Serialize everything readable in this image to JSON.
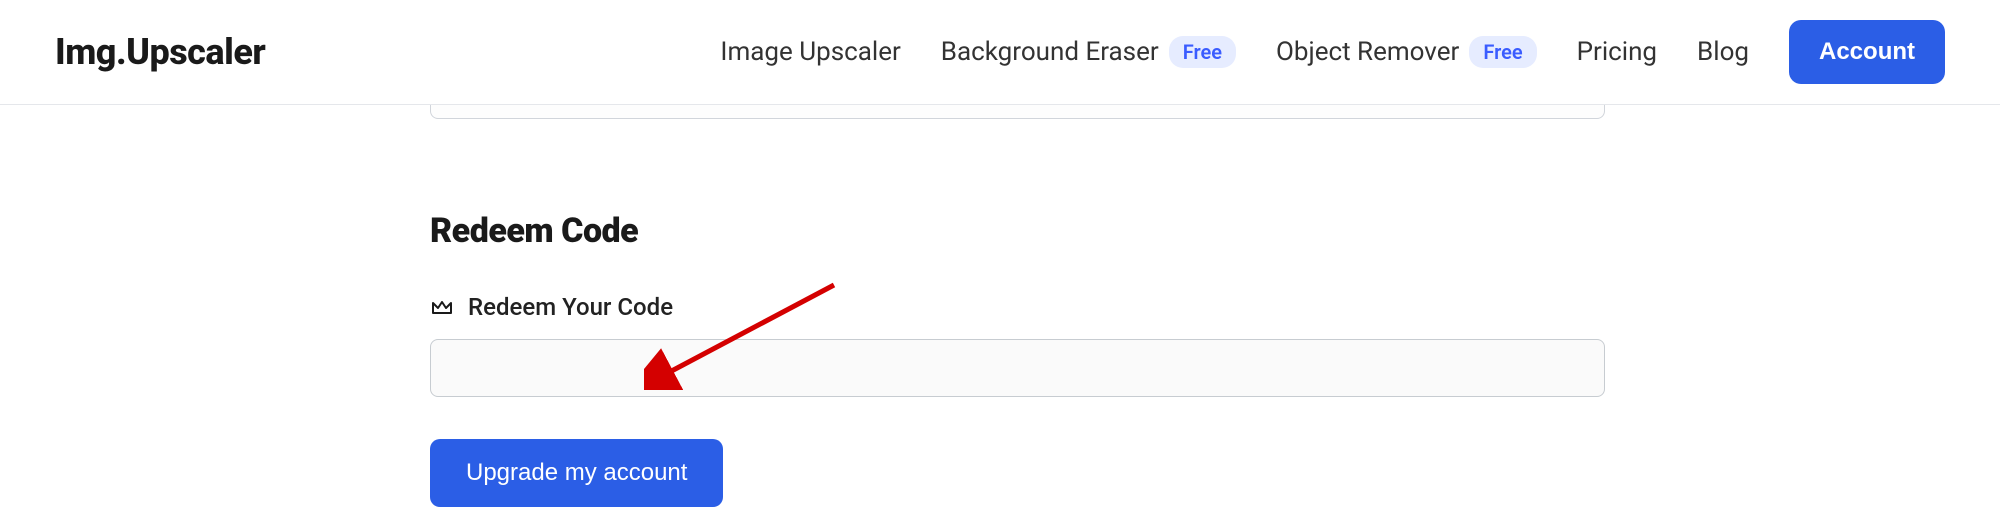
{
  "logo": "Img.Upscaler",
  "nav": {
    "image_upscaler": "Image Upscaler",
    "background_eraser": "Background Eraser",
    "object_remover": "Object Remover",
    "free_badge": "Free",
    "pricing": "Pricing",
    "blog": "Blog",
    "account_button": "Account"
  },
  "redeem": {
    "section_title": "Redeem Code",
    "field_label": "Redeem Your Code",
    "input_value": "",
    "upgrade_button": "Upgrade my account"
  }
}
